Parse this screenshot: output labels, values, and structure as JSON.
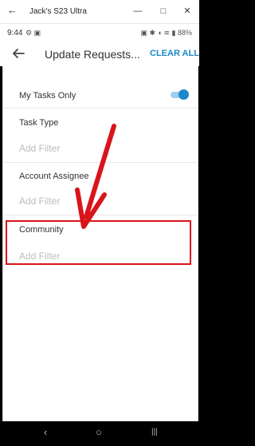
{
  "window": {
    "title": "Jack's S23 Ultra",
    "back_icon": "back-icon",
    "minimize_icon": "minimize-icon",
    "maximize_icon": "maximize-icon",
    "close_icon": "close-icon"
  },
  "status_bar": {
    "time": "9:44",
    "left_icons": "⚙ ▣",
    "right_icons": "▣ ✱ ◖ ≋ ▮",
    "battery": "88%"
  },
  "header": {
    "title": "Update Requests...",
    "clear_all": "CLEAR ALL"
  },
  "filters": {
    "my_tasks_label": "My Tasks Only",
    "my_tasks_on": true,
    "task_type_label": "Task Type",
    "task_type_placeholder": "Add Filter",
    "account_assignee_label": "Account Assignee",
    "account_assignee_placeholder": "Add Filter",
    "community_label": "Community",
    "community_placeholder": "Add Filter"
  },
  "annotation": {
    "arrow_color": "#d9141b",
    "box_color": "#d9141b"
  },
  "nav": {
    "back": "‹",
    "home": "○",
    "recents": "|||"
  },
  "colors": {
    "accent": "#1e88c9",
    "annotation": "#d9141b"
  }
}
